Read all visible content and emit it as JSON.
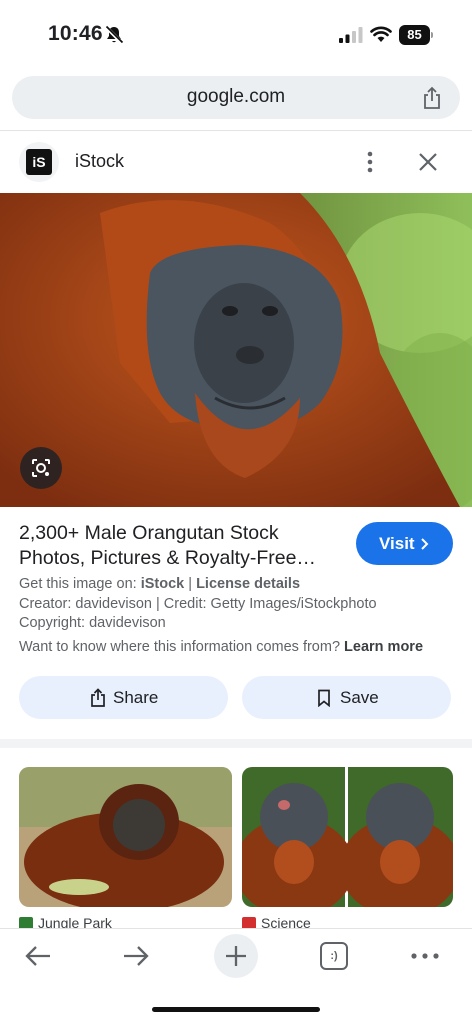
{
  "status_bar": {
    "time": "10:46",
    "battery": "85"
  },
  "browser": {
    "url": "google.com"
  },
  "source": {
    "name": "iStock",
    "logo_text": "iS"
  },
  "result": {
    "title": "2,300+ Male Orangutan Stock Photos, Pictures & Royalty-Free…",
    "visit_label": "Visit",
    "get_image_prefix": "Get this image on:",
    "get_image_source": "iStock",
    "separator": "|",
    "license_label": "License details",
    "creator_line": "Creator: davidevison | Credit: Getty Images/iStockphoto",
    "copyright_line": "Copyright: davidevison",
    "info_question": "Want to know where this information comes from?",
    "learn_more": "Learn more",
    "share_label": "Share",
    "save_label": "Save"
  },
  "related": [
    {
      "source": "Jungle Park",
      "favicon_color": "#2e7d32"
    },
    {
      "source": "Science",
      "favicon_color": "#d32f2f"
    }
  ],
  "colors": {
    "accent": "#1a73e8",
    "chip_bg": "#e8f0fe"
  },
  "toolbar": {
    "icons": [
      "back-arrow-icon",
      "forward-arrow-icon",
      "new-tab-plus-icon",
      "tab-switcher-icon",
      "more-dots-icon"
    ],
    "tab_count": ":)"
  }
}
